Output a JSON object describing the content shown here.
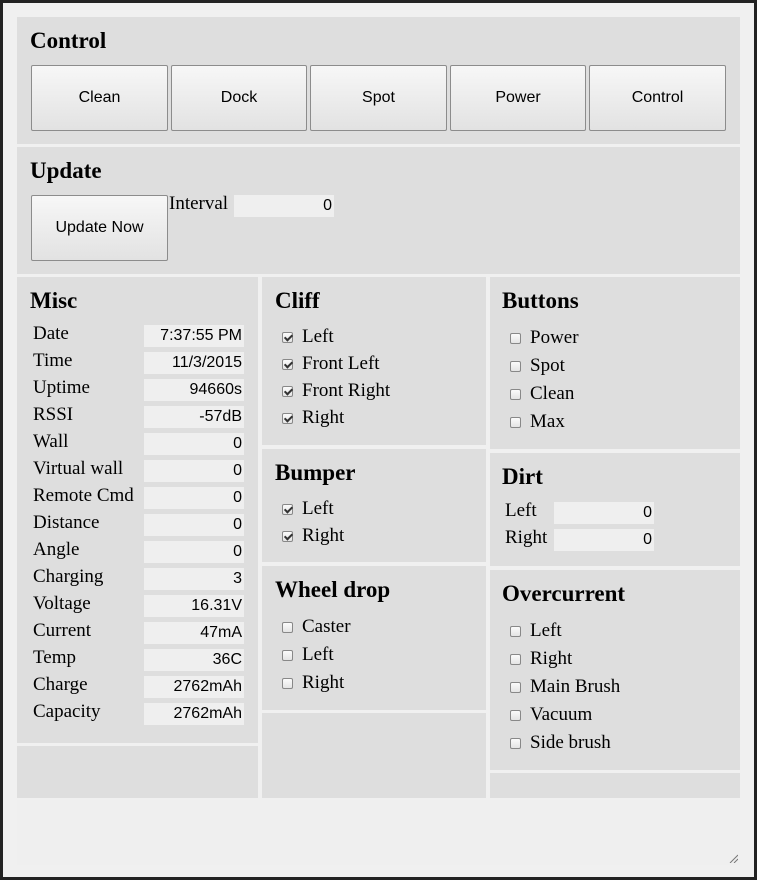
{
  "control": {
    "title": "Control",
    "buttons": [
      "Clean",
      "Dock",
      "Spot",
      "Power",
      "Control"
    ]
  },
  "update": {
    "title": "Update",
    "update_now_label": "Update Now",
    "interval_label": "Interval",
    "interval_value": "0"
  },
  "misc": {
    "title": "Misc",
    "rows": [
      {
        "label": "Date",
        "value": "7:37:55 PM"
      },
      {
        "label": "Time",
        "value": "11/3/2015"
      },
      {
        "label": "Uptime",
        "value": "94660s"
      },
      {
        "label": "RSSI",
        "value": "-57dB"
      },
      {
        "label": "Wall",
        "value": "0"
      },
      {
        "label": "Virtual wall",
        "value": "0"
      },
      {
        "label": "Remote Cmd",
        "value": "0"
      },
      {
        "label": "Distance",
        "value": "0"
      },
      {
        "label": "Angle",
        "value": "0"
      },
      {
        "label": "Charging",
        "value": "3"
      },
      {
        "label": "Voltage",
        "value": "16.31V"
      },
      {
        "label": "Current",
        "value": "47mA"
      },
      {
        "label": "Temp",
        "value": "36C"
      },
      {
        "label": "Charge",
        "value": "2762mAh"
      },
      {
        "label": "Capacity",
        "value": "2762mAh"
      }
    ]
  },
  "cliff": {
    "title": "Cliff",
    "items": [
      {
        "label": "Left",
        "checked": true
      },
      {
        "label": "Front Left",
        "checked": true
      },
      {
        "label": "Front Right",
        "checked": true
      },
      {
        "label": "Right",
        "checked": true
      }
    ]
  },
  "bumper": {
    "title": "Bumper",
    "items": [
      {
        "label": "Left",
        "checked": true
      },
      {
        "label": "Right",
        "checked": true
      }
    ]
  },
  "wheel_drop": {
    "title": "Wheel drop",
    "items": [
      {
        "label": "Caster",
        "checked": false
      },
      {
        "label": "Left",
        "checked": false
      },
      {
        "label": "Right",
        "checked": false
      }
    ]
  },
  "buttons": {
    "title": "Buttons",
    "items": [
      {
        "label": "Power",
        "checked": false
      },
      {
        "label": "Spot",
        "checked": false
      },
      {
        "label": "Clean",
        "checked": false
      },
      {
        "label": "Max",
        "checked": false
      }
    ]
  },
  "dirt": {
    "title": "Dirt",
    "rows": [
      {
        "label": "Left",
        "value": "0"
      },
      {
        "label": "Right",
        "value": "0"
      }
    ]
  },
  "overcurrent": {
    "title": "Overcurrent",
    "items": [
      {
        "label": "Left",
        "checked": false
      },
      {
        "label": "Right",
        "checked": false
      },
      {
        "label": "Main Brush",
        "checked": false
      },
      {
        "label": "Vacuum",
        "checked": false
      },
      {
        "label": "Side brush",
        "checked": false
      }
    ]
  },
  "log": {
    "value": ""
  }
}
